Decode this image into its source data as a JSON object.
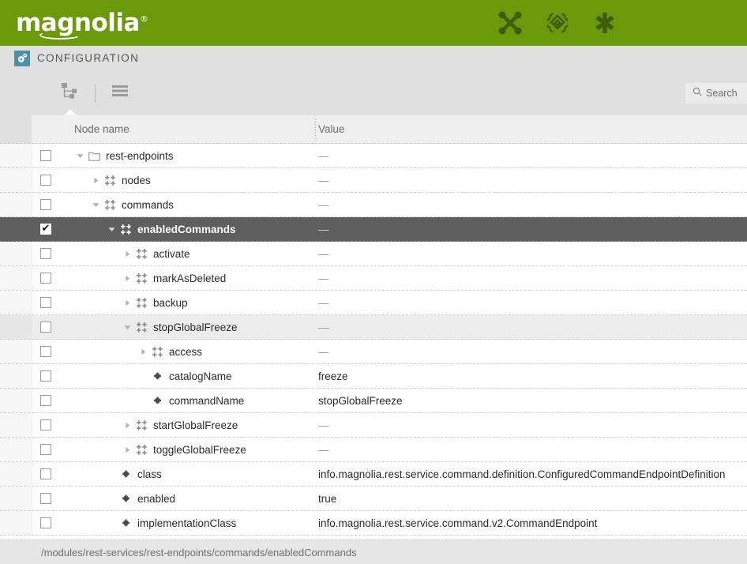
{
  "brand": {
    "name": "magnolia",
    "registered": "®",
    "bar_color": "#6a9a0a",
    "icon_color": "#3f5c08"
  },
  "topbar": {
    "icons": [
      {
        "name": "pulse-icon",
        "label": "Pulse"
      },
      {
        "name": "apps-icon",
        "label": "Apps"
      },
      {
        "name": "favorites-icon",
        "label": "Favorites"
      }
    ]
  },
  "appbar": {
    "icon": "configuration-gear-icon",
    "icon_bg": "#4f8fa6",
    "title": "CONFIGURATION"
  },
  "toolbar": {
    "views": [
      {
        "name": "tree-view-icon",
        "label": "Tree view",
        "active": true
      },
      {
        "name": "list-view-icon",
        "label": "List view",
        "active": false
      }
    ],
    "search": {
      "icon": "search-icon",
      "placeholder": "Search",
      "value": "Search"
    }
  },
  "table": {
    "columns": [
      {
        "key": "name",
        "label": "Node name"
      },
      {
        "key": "value",
        "label": "Value"
      }
    ],
    "rows": [
      {
        "checked": false,
        "state": "normal",
        "indent": 0,
        "twisty": "down",
        "icon": "folder-icon",
        "name": "rest-endpoints",
        "value": "—",
        "is_dash": true
      },
      {
        "checked": false,
        "state": "normal",
        "indent": 1,
        "twisty": "right",
        "icon": "node-icon",
        "name": "nodes",
        "value": "—",
        "is_dash": true
      },
      {
        "checked": false,
        "state": "normal",
        "indent": 1,
        "twisty": "down",
        "icon": "node-icon",
        "name": "commands",
        "value": "—",
        "is_dash": true
      },
      {
        "checked": true,
        "state": "selected",
        "indent": 2,
        "twisty": "down",
        "icon": "node-icon",
        "name": "enabledCommands",
        "value": "—",
        "is_dash": true
      },
      {
        "checked": false,
        "state": "normal",
        "indent": 3,
        "twisty": "right",
        "icon": "node-icon",
        "name": "activate",
        "value": "—",
        "is_dash": true
      },
      {
        "checked": false,
        "state": "normal",
        "indent": 3,
        "twisty": "right",
        "icon": "node-icon",
        "name": "markAsDeleted",
        "value": "—",
        "is_dash": true
      },
      {
        "checked": false,
        "state": "normal",
        "indent": 3,
        "twisty": "right",
        "icon": "node-icon",
        "name": "backup",
        "value": "—",
        "is_dash": true
      },
      {
        "checked": false,
        "state": "hover",
        "indent": 3,
        "twisty": "down",
        "icon": "node-icon",
        "name": "stopGlobalFreeze",
        "value": "—",
        "is_dash": true
      },
      {
        "checked": false,
        "state": "normal",
        "indent": 4,
        "twisty": "right",
        "icon": "node-icon",
        "name": "access",
        "value": "—",
        "is_dash": true
      },
      {
        "checked": false,
        "state": "normal",
        "indent": 4,
        "twisty": "none",
        "icon": "property-icon",
        "name": "catalogName",
        "value": "freeze",
        "is_dash": false
      },
      {
        "checked": false,
        "state": "normal",
        "indent": 4,
        "twisty": "none",
        "icon": "property-icon",
        "name": "commandName",
        "value": "stopGlobalFreeze",
        "is_dash": false
      },
      {
        "checked": false,
        "state": "normal",
        "indent": 3,
        "twisty": "right",
        "icon": "node-icon",
        "name": "startGlobalFreeze",
        "value": "—",
        "is_dash": true
      },
      {
        "checked": false,
        "state": "normal",
        "indent": 3,
        "twisty": "right",
        "icon": "node-icon",
        "name": "toggleGlobalFreeze",
        "value": "—",
        "is_dash": true
      },
      {
        "checked": false,
        "state": "normal",
        "indent": 2,
        "twisty": "none",
        "icon": "property-icon",
        "name": "class",
        "value": "info.magnolia.rest.service.command.definition.ConfiguredCommandEndpointDefinition",
        "is_dash": false
      },
      {
        "checked": false,
        "state": "normal",
        "indent": 2,
        "twisty": "none",
        "icon": "property-icon",
        "name": "enabled",
        "value": "true",
        "is_dash": false
      },
      {
        "checked": false,
        "state": "normal",
        "indent": 2,
        "twisty": "none",
        "icon": "property-icon",
        "name": "implementationClass",
        "value": "info.magnolia.rest.service.command.v2.CommandEndpoint",
        "is_dash": false
      }
    ]
  },
  "statusbar": {
    "path": "/modules/rest-services/rest-endpoints/commands/enabledCommands"
  }
}
